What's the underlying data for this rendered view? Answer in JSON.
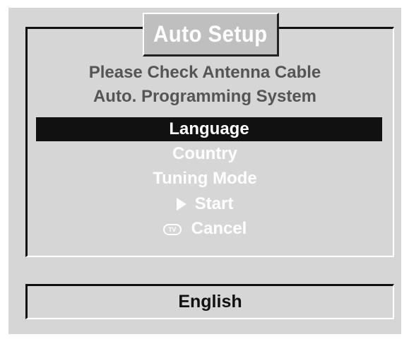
{
  "dialog": {
    "title": "Auto Setup",
    "info_lines": [
      "Please Check Antenna Cable",
      "Auto. Programming System"
    ]
  },
  "menu": {
    "items": [
      {
        "label": "Language",
        "selected": true
      },
      {
        "label": "Country",
        "selected": false
      },
      {
        "label": "Tuning Mode",
        "selected": false
      },
      {
        "label": "Start",
        "selected": false,
        "icon": "play-triangle-icon"
      },
      {
        "label": "Cancel",
        "selected": false,
        "icon": "tv-button-icon",
        "icon_text": "TV"
      }
    ]
  },
  "value_box": {
    "value": "English"
  },
  "colors": {
    "background": "#d6d6d6",
    "selection": "#111111",
    "title_box": "#bfbfbf",
    "info_text": "#555555",
    "menu_text": "#ffffff"
  }
}
